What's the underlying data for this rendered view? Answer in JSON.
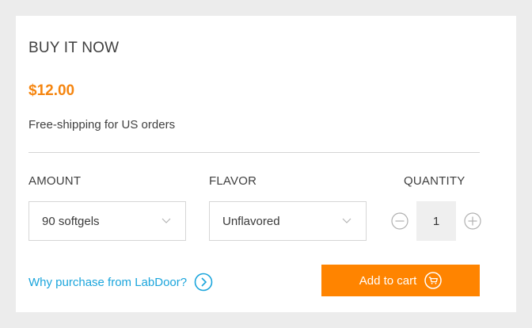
{
  "section_title": "BUY IT NOW",
  "price": "$12.00",
  "shipping_note": "Free-shipping for US orders",
  "options": {
    "amount": {
      "label": "AMOUNT",
      "selected": "90 softgels"
    },
    "flavor": {
      "label": "FLAVOR",
      "selected": "Unflavored"
    },
    "quantity": {
      "label": "QUANTITY",
      "value": "1"
    }
  },
  "why_link": {
    "text": "Why purchase from LabDoor?",
    "icon": "chevron-right-circle-icon"
  },
  "cart_button": {
    "label": "Add to cart",
    "icon": "cart-circle-icon"
  },
  "colors": {
    "accent": "#ff8400",
    "price": "#f5850f",
    "link": "#1ba5dc",
    "background": "#ececec"
  }
}
